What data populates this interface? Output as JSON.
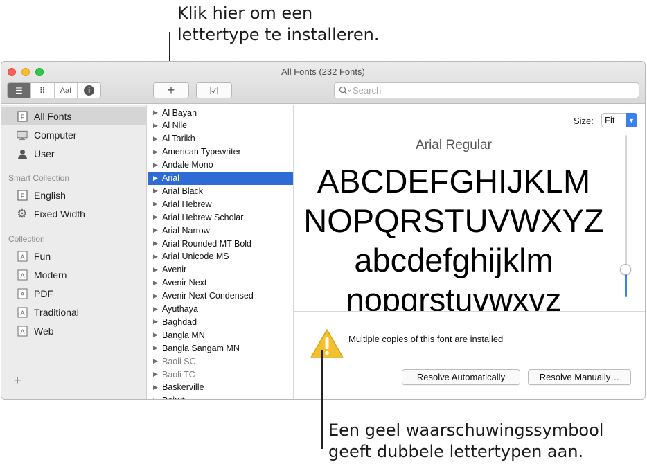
{
  "annotations": {
    "top": [
      "Klik hier om een",
      "lettertype te installeren."
    ],
    "bottom": [
      "Een geel waarschuwingssymbool",
      "geeft dubbele lettertypen aan."
    ]
  },
  "window": {
    "title": "All Fonts (232 Fonts)"
  },
  "toolbar": {
    "view_buttons": [
      {
        "name": "list-view-icon",
        "glyph": "☰"
      },
      {
        "name": "grid-view-icon",
        "glyph": "⠿"
      },
      {
        "name": "sample-view-icon",
        "glyph": "AaI"
      },
      {
        "name": "info-view-icon",
        "glyph": "i"
      }
    ],
    "install_glyph": "+",
    "validate_glyph": "☑",
    "search_placeholder": "Search"
  },
  "sidebar": {
    "library_items": [
      {
        "label": "All Fonts",
        "icon": "font-library-icon",
        "selected": true
      },
      {
        "label": "Computer",
        "icon": "computer-icon"
      },
      {
        "label": "User",
        "icon": "user-icon"
      }
    ],
    "smart_collection_header": "Smart Collection",
    "smart_items": [
      {
        "label": "English",
        "icon": "font-library-icon"
      },
      {
        "label": "Fixed Width",
        "icon": "gear-icon"
      }
    ],
    "collection_header": "Collection",
    "collection_items": [
      {
        "label": "Fun",
        "icon": "collection-icon"
      },
      {
        "label": "Modern",
        "icon": "collection-icon"
      },
      {
        "label": "PDF",
        "icon": "collection-icon"
      },
      {
        "label": "Traditional",
        "icon": "collection-icon"
      },
      {
        "label": "Web",
        "icon": "collection-icon"
      }
    ],
    "add_glyph": "+"
  },
  "font_list": [
    {
      "name": "Al Bayan"
    },
    {
      "name": "Al Nile"
    },
    {
      "name": "Al Tarikh"
    },
    {
      "name": "American Typewriter"
    },
    {
      "name": "Andale Mono"
    },
    {
      "name": "Arial",
      "selected": true
    },
    {
      "name": "Arial Black"
    },
    {
      "name": "Arial Hebrew"
    },
    {
      "name": "Arial Hebrew Scholar"
    },
    {
      "name": "Arial Narrow"
    },
    {
      "name": "Arial Rounded MT Bold"
    },
    {
      "name": "Arial Unicode MS"
    },
    {
      "name": "Avenir"
    },
    {
      "name": "Avenir Next"
    },
    {
      "name": "Avenir Next Condensed"
    },
    {
      "name": "Ayuthaya"
    },
    {
      "name": "Baghdad"
    },
    {
      "name": "Bangla MN"
    },
    {
      "name": "Bangla Sangam MN"
    },
    {
      "name": "Baoli SC",
      "dim": true
    },
    {
      "name": "Baoli TC",
      "dim": true
    },
    {
      "name": "Baskerville"
    },
    {
      "name": "Beirut"
    }
  ],
  "preview": {
    "size_label": "Size:",
    "size_value": "Fit",
    "face_name": "Arial Regular",
    "sample_lines": [
      "ABCDEFGHIJKLM",
      "NOPQRSTUVWXYZ",
      "abcdefghijklm",
      "nopqrstuvwxyz"
    ],
    "slider_level": 0.17
  },
  "warning": {
    "message": "Multiple copies of this font are installed",
    "resolve_auto": "Resolve Automatically",
    "resolve_manual": "Resolve Manually…"
  },
  "colors": {
    "selection": "#2f6bd4",
    "accent": "#3b7ff0",
    "warning_yellow": "#f3c12b"
  }
}
